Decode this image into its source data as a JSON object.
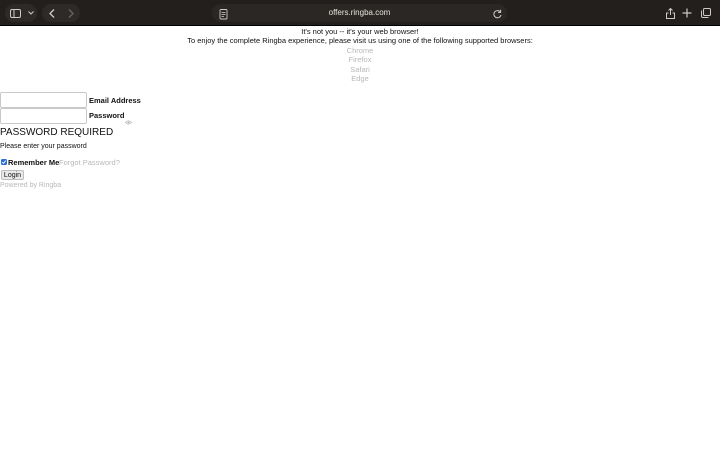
{
  "browser": {
    "url": "offers.ringba.com",
    "icons": {
      "sidebar": "sidebar-icon",
      "back": "chevron-left-icon",
      "forward": "chevron-right-icon",
      "reload": "reload-icon",
      "share": "share-icon",
      "new_tab": "plus-icon",
      "tabs": "tabs-icon"
    }
  },
  "notice": {
    "line1": "It's not you -- it's your web browser!",
    "line2": "To enjoy the complete Ringba experience, please visit us using one of the following supported browsers:",
    "browsers": [
      "Chrome",
      "Firefox",
      "Safari",
      "Edge"
    ]
  },
  "form": {
    "email_label": "Email Address",
    "email_value": "",
    "password_label": "Password",
    "password_value": "",
    "heading": "PASSWORD REQUIRED",
    "subtext": "Please enter your password",
    "remember_label": "Remember Me",
    "remember_checked": true,
    "forgot_label": "Forgot Password?",
    "login_label": "Login"
  },
  "footer": {
    "powered": "Powered by Ringba"
  },
  "colors": {
    "toolbar": "#221f1d",
    "muted_text": "#b8b8b8",
    "checkbox": "#2a6fd6"
  }
}
